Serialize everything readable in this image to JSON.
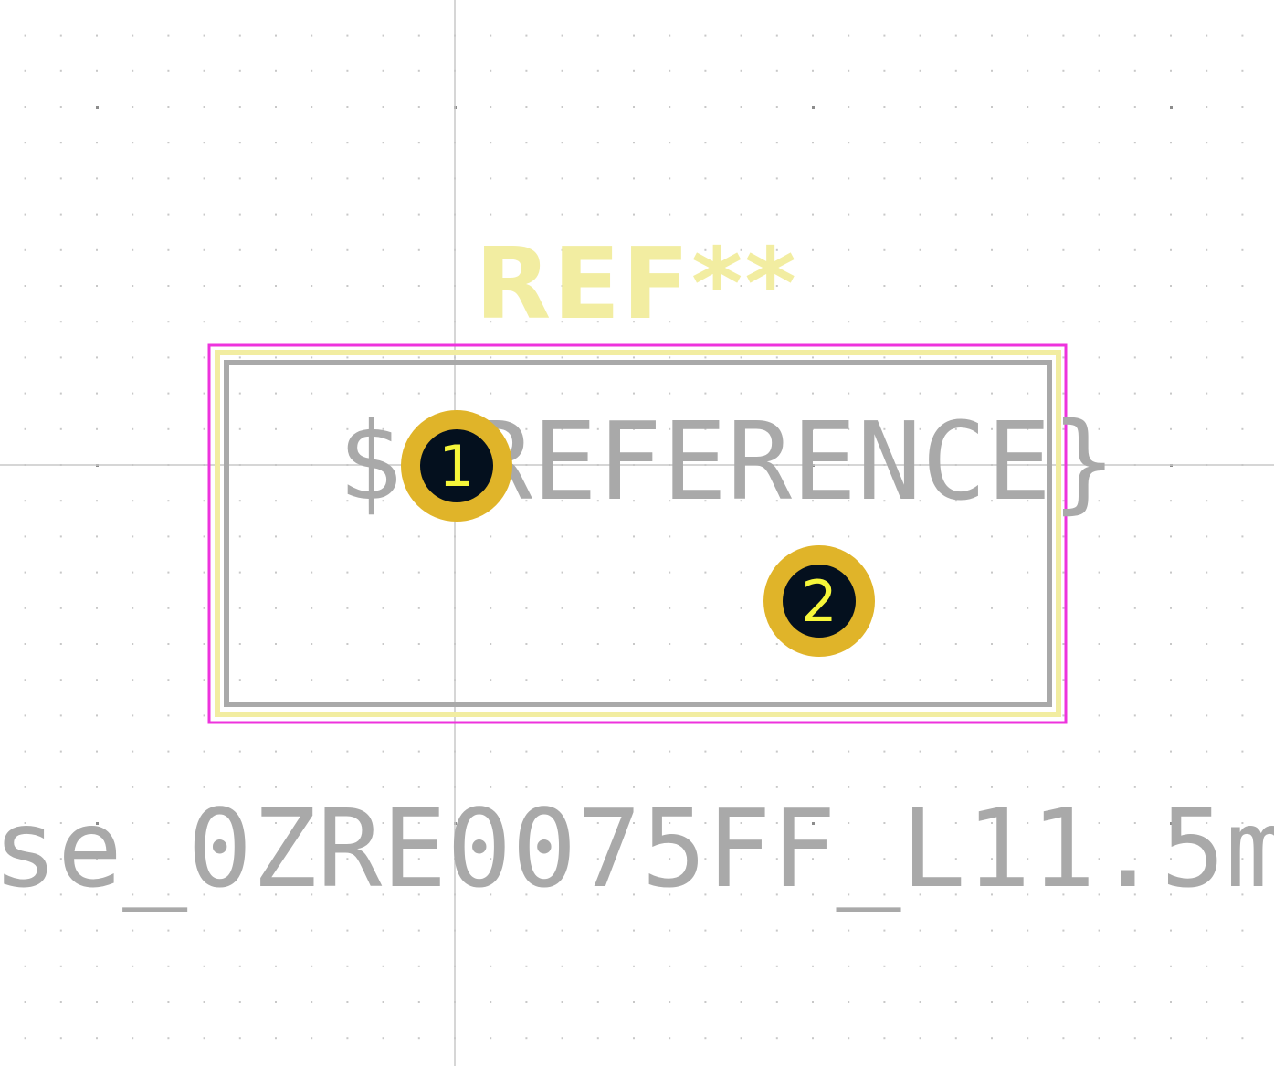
{
  "footprint": {
    "reference_label": "REF**",
    "reference_placeholder": "${REFERENCE}",
    "value_label": "se_0ZRE0075FF_L11.5m",
    "pads": [
      {
        "number": "1"
      },
      {
        "number": "2"
      }
    ]
  },
  "colors": {
    "background": "#ffffff",
    "grid_dot": "#c8c8c8",
    "grid_dot_major": "#8c8c8c",
    "crosshair": "#c8c8c8",
    "courtyard": "#ee33dd",
    "silkscreen": "#f2eda1",
    "fab_outline": "#a9a9a9",
    "fab_text": "#a9a9a9",
    "pad_copper": "#e0b429",
    "pad_hole": "#04101e",
    "pad_number": "#f6f63a"
  }
}
